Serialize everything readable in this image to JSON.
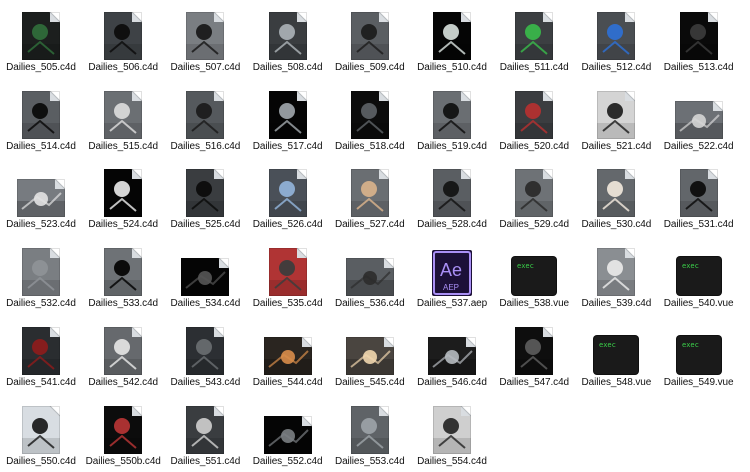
{
  "files": [
    {
      "name": "Dailies_505.c4d",
      "kind": "c4d",
      "bg": "#1c1f1e",
      "accent": "#2f6b3a"
    },
    {
      "name": "Dailies_506.c4d",
      "kind": "c4d",
      "bg": "#3e4246",
      "accent": "#0d0d0d"
    },
    {
      "name": "Dailies_507.c4d",
      "kind": "c4d",
      "bg": "#7a7e82",
      "accent": "#1a1a1a"
    },
    {
      "name": "Dailies_508.c4d",
      "kind": "c4d",
      "bg": "#3a3d40",
      "accent": "#a7adb2"
    },
    {
      "name": "Dailies_509.c4d",
      "kind": "c4d",
      "bg": "#5a5e62",
      "accent": "#1e1e1e"
    },
    {
      "name": "Dailies_510.c4d",
      "kind": "c4d",
      "bg": "#050505",
      "accent": "#cfd7d3"
    },
    {
      "name": "Dailies_511.c4d",
      "kind": "c4d",
      "bg": "#3c3f42",
      "accent": "#39b54a"
    },
    {
      "name": "Dailies_512.c4d",
      "kind": "c4d",
      "bg": "#4a4e52",
      "accent": "#2e6fd1"
    },
    {
      "name": "Dailies_513.c4d",
      "kind": "c4d",
      "bg": "#0a0a0a",
      "accent": "#3a3a3a"
    },
    {
      "name": "Dailies_514.c4d",
      "kind": "c4d",
      "bg": "#5a5e62",
      "accent": "#0b0b0b"
    },
    {
      "name": "Dailies_515.c4d",
      "kind": "c4d",
      "bg": "#6b6f73",
      "accent": "#d8d8d8"
    },
    {
      "name": "Dailies_516.c4d",
      "kind": "c4d",
      "bg": "#55595d",
      "accent": "#1c1c1c"
    },
    {
      "name": "Dailies_517.c4d",
      "kind": "c4d",
      "bg": "#050505",
      "accent": "#9aa0a5"
    },
    {
      "name": "Dailies_518.c4d",
      "kind": "c4d",
      "bg": "#0c0c0c",
      "accent": "#5b5f63"
    },
    {
      "name": "Dailies_519.c4d",
      "kind": "c4d",
      "bg": "#6a6e72",
      "accent": "#111111"
    },
    {
      "name": "Dailies_520.c4d",
      "kind": "c4d",
      "bg": "#3b3d40",
      "accent": "#b23030"
    },
    {
      "name": "Dailies_521.c4d",
      "kind": "c4d",
      "bg": "#d4d4d4",
      "accent": "#222222"
    },
    {
      "name": "Dailies_522.c4d",
      "kind": "wide",
      "bg": "#6c7075",
      "accent": "#d5d5d5"
    },
    {
      "name": "Dailies_523.c4d",
      "kind": "wide",
      "bg": "#777b80",
      "accent": "#e2e2e2"
    },
    {
      "name": "Dailies_524.c4d",
      "kind": "c4d",
      "bg": "#050505",
      "accent": "#e0e0e0"
    },
    {
      "name": "Dailies_525.c4d",
      "kind": "c4d",
      "bg": "#3a3d40",
      "accent": "#0c0c0c"
    },
    {
      "name": "Dailies_526.c4d",
      "kind": "c4d",
      "bg": "#4a5058",
      "accent": "#8fb0d6"
    },
    {
      "name": "Dailies_527.c4d",
      "kind": "c4d",
      "bg": "#6a6e72",
      "accent": "#d6b08a"
    },
    {
      "name": "Dailies_528.c4d",
      "kind": "c4d",
      "bg": "#5a5e62",
      "accent": "#141414"
    },
    {
      "name": "Dailies_529.c4d",
      "kind": "c4d",
      "bg": "#6e7276",
      "accent": "#2b2b2b"
    },
    {
      "name": "Dailies_530.c4d",
      "kind": "c4d",
      "bg": "#64686c",
      "accent": "#ece4d8"
    },
    {
      "name": "Dailies_531.c4d",
      "kind": "c4d",
      "bg": "#62666a",
      "accent": "#0d0d0d"
    },
    {
      "name": "Dailies_532.c4d",
      "kind": "c4d",
      "bg": "#7a7e82",
      "accent": "#8e9296"
    },
    {
      "name": "Dailies_533.c4d",
      "kind": "c4d",
      "bg": "#6e7276",
      "accent": "#050505"
    },
    {
      "name": "Dailies_534.c4d",
      "kind": "wide",
      "bg": "#050505",
      "accent": "#565656"
    },
    {
      "name": "Dailies_535.c4d",
      "kind": "c4d",
      "bg": "#b03434",
      "accent": "#3d3d3d"
    },
    {
      "name": "Dailies_536.c4d",
      "kind": "wide",
      "bg": "#5a5e62",
      "accent": "#2c2c2c"
    },
    {
      "name": "Dailies_537.aep",
      "kind": "ae",
      "bg": "#1c1038",
      "accent": "#a98ff5"
    },
    {
      "name": "Dailies_538.vue",
      "kind": "term",
      "bg": "#1a1a1a",
      "accent": "#3ad24a"
    },
    {
      "name": "Dailies_539.c4d",
      "kind": "c4d",
      "bg": "#8a8e92",
      "accent": "#e7e7e7"
    },
    {
      "name": "Dailies_540.vue",
      "kind": "term",
      "bg": "#1a1a1a",
      "accent": "#3ad24a"
    },
    {
      "name": "Dailies_541.c4d",
      "kind": "c4d",
      "bg": "#2a2d30",
      "accent": "#8a1c1c"
    },
    {
      "name": "Dailies_542.c4d",
      "kind": "c4d",
      "bg": "#66696d",
      "accent": "#e0e0e0"
    },
    {
      "name": "Dailies_543.c4d",
      "kind": "c4d",
      "bg": "#2c2f33",
      "accent": "#676b6f"
    },
    {
      "name": "Dailies_544.c4d",
      "kind": "wide",
      "bg": "#2a2520",
      "accent": "#d88d4a"
    },
    {
      "name": "Dailies_545.c4d",
      "kind": "wide",
      "bg": "#4a4540",
      "accent": "#f1d6ae"
    },
    {
      "name": "Dailies_546.c4d",
      "kind": "wide",
      "bg": "#1c1c1c",
      "accent": "#b6bbc0"
    },
    {
      "name": "Dailies_547.c4d",
      "kind": "c4d",
      "bg": "#0e0e0e",
      "accent": "#5a5a5a"
    },
    {
      "name": "Dailies_548.vue",
      "kind": "term",
      "bg": "#1a1a1a",
      "accent": "#3ad24a"
    },
    {
      "name": "Dailies_549.vue",
      "kind": "term",
      "bg": "#1a1a1a",
      "accent": "#3ad24a"
    },
    {
      "name": "Dailies_550.c4d",
      "kind": "c4d",
      "bg": "#d8dde2",
      "accent": "#1e1e1e"
    },
    {
      "name": "Dailies_550b.c4d",
      "kind": "c4d",
      "bg": "#0c0c0c",
      "accent": "#b23434"
    },
    {
      "name": "Dailies_551.c4d",
      "kind": "c4d",
      "bg": "#3a3d40",
      "accent": "#c8c8c8"
    },
    {
      "name": "Dailies_552.c4d",
      "kind": "wide",
      "bg": "#050505",
      "accent": "#7b7f83"
    },
    {
      "name": "Dailies_553.c4d",
      "kind": "c4d",
      "bg": "#5f6367",
      "accent": "#9aa0a5"
    },
    {
      "name": "Dailies_554.c4d",
      "kind": "c4d",
      "bg": "#cfcfcf",
      "accent": "#2a2a2a"
    }
  ],
  "ae_icon": {
    "title": "Ae",
    "subtitle": "AEP"
  },
  "term_icon": {
    "label": "exec"
  }
}
